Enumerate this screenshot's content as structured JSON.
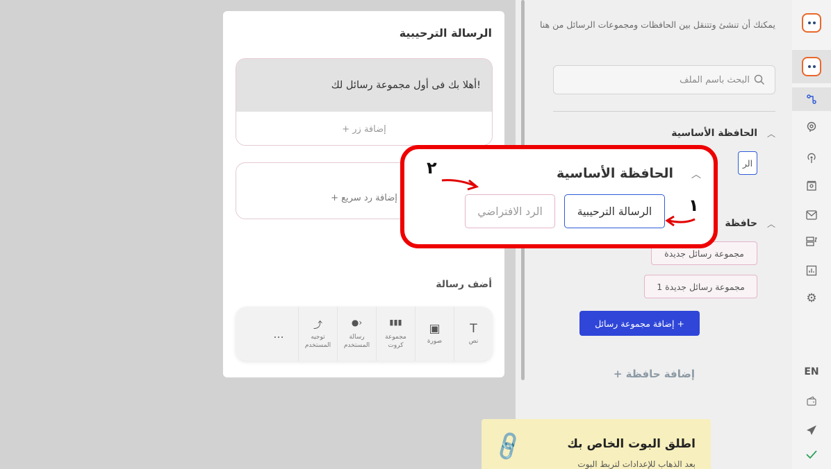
{
  "sidebar": {
    "icons": [
      {
        "name": "bot-logo-icon",
        "active": false
      },
      {
        "name": "bot-logo-icon",
        "active": true
      },
      {
        "name": "flow-icon",
        "active": true
      },
      {
        "name": "brain-icon"
      },
      {
        "name": "broadcast-icon"
      },
      {
        "name": "contacts-icon"
      },
      {
        "name": "mail-icon"
      },
      {
        "name": "templates-icon"
      },
      {
        "name": "analytics-icon"
      },
      {
        "name": "settings-gear-icon"
      }
    ],
    "language": "EN",
    "bottom_icons": [
      "wallet-icon",
      "send-icon",
      "check-icon"
    ]
  },
  "nav_panel": {
    "description": "يمكنك أن تنشئ وتتنقل بين الحافظات ومجموعات الرسائل من هنا",
    "search_placeholder": "البحث باسم الملف",
    "main_folder": "الحافظة الأساسية",
    "main_folder_tag": "الر",
    "second_folder": "حافظة",
    "groups": [
      "مجموعة رسائل جديدة",
      "مجموعة رسائل جديدة 1"
    ],
    "add_group": "إضافة مجموعة رسائل +",
    "add_folder": "+ إضافة حافظة",
    "launch_title": "اطلق البوت الخاص بك",
    "launch_subtitle": "بعد الذهاب للإعدادات لتربط البوت"
  },
  "card": {
    "title": "الرسالة الترحيبية",
    "message": "أهلا بك فى أول مجموعة رسائل لك!",
    "add_button": "+ إضافة زر",
    "add_quick_reply": "+ إضافة رد سريع",
    "add_message_label": "أضف رسالة",
    "tools": [
      {
        "icon": "text-icon",
        "glyph": "T",
        "label": "نص"
      },
      {
        "icon": "image-icon",
        "glyph": "▣",
        "label": "صورة"
      },
      {
        "icon": "cards-icon",
        "glyph": "▮▮▮",
        "label": "مجموعة كروت"
      },
      {
        "icon": "user-message-icon",
        "glyph": "●›",
        "label": "رسالة المستخدم"
      },
      {
        "icon": "redirect-user-icon",
        "glyph": "⤴",
        "label": "توجيه المستخدم"
      }
    ],
    "more": "..."
  },
  "callout": {
    "folder_title": "الحافظة الأساسية",
    "tab_primary": "الرسالة الترحيبية",
    "tab_secondary": "الرد الافتراضي",
    "label_1": "١",
    "label_2": "٢"
  }
}
